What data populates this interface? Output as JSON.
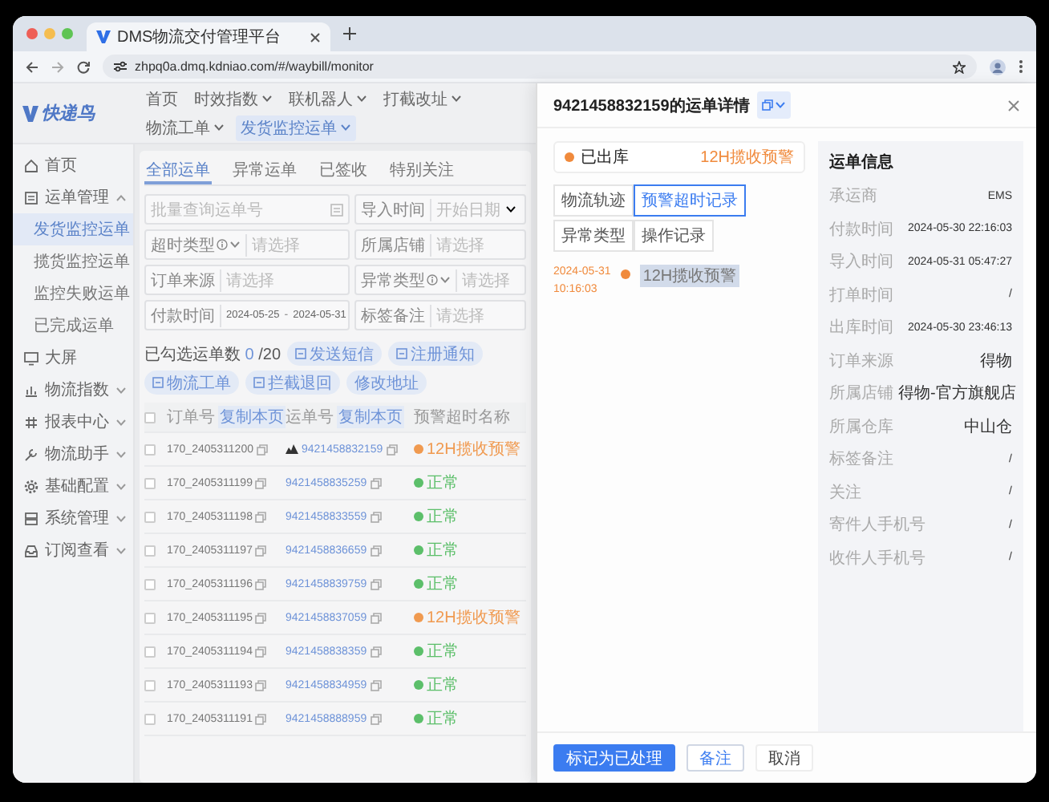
{
  "browser": {
    "tab_title": "DMS物流交付管理平台",
    "url": "zhpq0a.dmq.kdniao.com/#/waybill/monitor"
  },
  "app": {
    "logo": "快递鸟"
  },
  "nav": [
    {
      "label": "首页",
      "dropdown": false,
      "selected": false
    },
    {
      "label": "时效指数",
      "dropdown": true,
      "selected": false
    },
    {
      "label": "联机器人",
      "dropdown": true,
      "selected": false
    },
    {
      "label": "打截改址",
      "dropdown": true,
      "selected": false
    },
    {
      "label": "物流工单",
      "dropdown": true,
      "selected": false
    },
    {
      "label": "发货监控运单",
      "dropdown": true,
      "selected": true
    }
  ],
  "sidebar": {
    "items": [
      {
        "label": "首页",
        "kind": "link",
        "selected": false
      },
      {
        "label": "运单管理",
        "kind": "group",
        "expanded": true,
        "selected": false,
        "children": [
          {
            "label": "发货监控运单",
            "selected": true
          },
          {
            "label": "揽货监控运单",
            "selected": false
          },
          {
            "label": "监控失败运单",
            "selected": false
          },
          {
            "label": "已完成运单",
            "selected": false
          }
        ]
      },
      {
        "label": "大屏",
        "kind": "link",
        "selected": false
      },
      {
        "label": "物流指数",
        "kind": "group",
        "expanded": false,
        "selected": false
      },
      {
        "label": "报表中心",
        "kind": "group",
        "expanded": false,
        "selected": false
      },
      {
        "label": "物流助手",
        "kind": "group",
        "expanded": false,
        "selected": false
      },
      {
        "label": "基础配置",
        "kind": "group",
        "expanded": false,
        "selected": false
      },
      {
        "label": "系统管理",
        "kind": "group",
        "expanded": false,
        "selected": false
      },
      {
        "label": "订阅查看",
        "kind": "group",
        "expanded": false,
        "selected": false
      }
    ]
  },
  "main": {
    "tabs": [
      {
        "label": "全部运单",
        "selected": true
      },
      {
        "label": "异常运单",
        "selected": false
      },
      {
        "label": "已签收",
        "selected": false
      },
      {
        "label": "特别关注",
        "selected": false
      }
    ],
    "filters": [
      {
        "kind": "search",
        "placeholder": "批量查询运单号"
      },
      {
        "kind": "daterange",
        "label": "导入时间",
        "placeholder": "开始日期"
      },
      {
        "kind": "select",
        "label": "超时类型",
        "help": true,
        "placeholder": "请选择"
      },
      {
        "kind": "select",
        "label": "所属店铺",
        "help": false,
        "placeholder": "请选择"
      },
      {
        "kind": "select",
        "label": "订单来源",
        "help": false,
        "placeholder": "请选择"
      },
      {
        "kind": "select",
        "label": "异常类型",
        "help": true,
        "placeholder": "请选择"
      },
      {
        "kind": "range",
        "label": "付款时间",
        "start": "2024-05-25",
        "separator": "-",
        "end": "2024-05-31"
      },
      {
        "kind": "select",
        "label": "标签备注",
        "help": false,
        "placeholder": "请选择"
      }
    ],
    "selection": {
      "label": "已勾选运单数",
      "count": "0",
      "total": "/20"
    },
    "actions": [
      {
        "label": "发送短信",
        "icon": true
      },
      {
        "label": "注册通知",
        "icon": true
      },
      {
        "label": "物流工单",
        "icon": true
      },
      {
        "label": "拦截退回",
        "icon": true
      },
      {
        "label": "修改地址",
        "icon": false
      }
    ],
    "table": {
      "all_checked": false,
      "columns": [
        {
          "label": "订单号",
          "tag": "复制本页"
        },
        {
          "label": "运单号",
          "tag": "复制本页"
        },
        {
          "label": "预警超时名称"
        }
      ],
      "rows": [
        {
          "checked": false,
          "order_no": "170_2405311200",
          "waybill_no": "9421458832159",
          "flagged": true,
          "status": "12H揽收预警",
          "color": "#f09a50"
        },
        {
          "checked": false,
          "order_no": "170_2405311199",
          "waybill_no": "9421458835259",
          "flagged": false,
          "status": "正常",
          "color": "#5cbf6a"
        },
        {
          "checked": false,
          "order_no": "170_2405311198",
          "waybill_no": "9421458833559",
          "flagged": false,
          "status": "正常",
          "color": "#5cbf6a"
        },
        {
          "checked": false,
          "order_no": "170_2405311197",
          "waybill_no": "9421458836659",
          "flagged": false,
          "status": "正常",
          "color": "#5cbf6a"
        },
        {
          "checked": false,
          "order_no": "170_2405311196",
          "waybill_no": "9421458839759",
          "flagged": false,
          "status": "正常",
          "color": "#5cbf6a"
        },
        {
          "checked": false,
          "order_no": "170_2405311195",
          "waybill_no": "9421458837059",
          "flagged": false,
          "status": "12H揽收预警",
          "color": "#f09a50"
        },
        {
          "checked": false,
          "order_no": "170_2405311194",
          "waybill_no": "9421458838359",
          "flagged": false,
          "status": "正常",
          "color": "#5cbf6a"
        },
        {
          "checked": false,
          "order_no": "170_2405311193",
          "waybill_no": "9421458834959",
          "flagged": false,
          "status": "正常",
          "color": "#5cbf6a"
        },
        {
          "checked": false,
          "order_no": "170_2405311191",
          "waybill_no": "9421458888959",
          "flagged": false,
          "status": "正常",
          "color": "#5cbf6a"
        }
      ]
    }
  },
  "drawer": {
    "title": "9421458832159的运单详情",
    "status": "已出库",
    "warning": "12H揽收预警",
    "tabs": [
      {
        "label": "物流轨迹",
        "selected": false
      },
      {
        "label": "预警超时记录",
        "selected": true
      },
      {
        "label": "异常类型",
        "selected": false
      },
      {
        "label": "操作记录",
        "selected": false
      }
    ],
    "timeline": [
      {
        "date": "2024-05-31",
        "time": "10:16:03",
        "event": "12H揽收预警"
      }
    ],
    "info": {
      "title": "运单信息",
      "rows": [
        {
          "label": "承运商",
          "value": "EMS"
        },
        {
          "label": "付款时间",
          "value": "2024-05-30 22:16:03"
        },
        {
          "label": "导入时间",
          "value": "2024-05-31 05:47:27"
        },
        {
          "label": "打单时间",
          "value": "/"
        },
        {
          "label": "出库时间",
          "value": "2024-05-30 23:46:13"
        },
        {
          "label": "订单来源",
          "value": "得物"
        },
        {
          "label": "所属店铺",
          "value": "得物-官方旗舰店"
        },
        {
          "label": "所属仓库",
          "value": "中山仓"
        },
        {
          "label": "标签备注",
          "value": "/"
        },
        {
          "label": "关注",
          "value": "/"
        },
        {
          "label": "寄件人手机号",
          "value": "/"
        },
        {
          "label": "收件人手机号",
          "value": "/"
        }
      ]
    },
    "buttons": [
      {
        "label": "标记为已处理",
        "kind": "primary"
      },
      {
        "label": "备注",
        "kind": "outline"
      },
      {
        "label": "取消",
        "kind": "plain"
      }
    ]
  }
}
